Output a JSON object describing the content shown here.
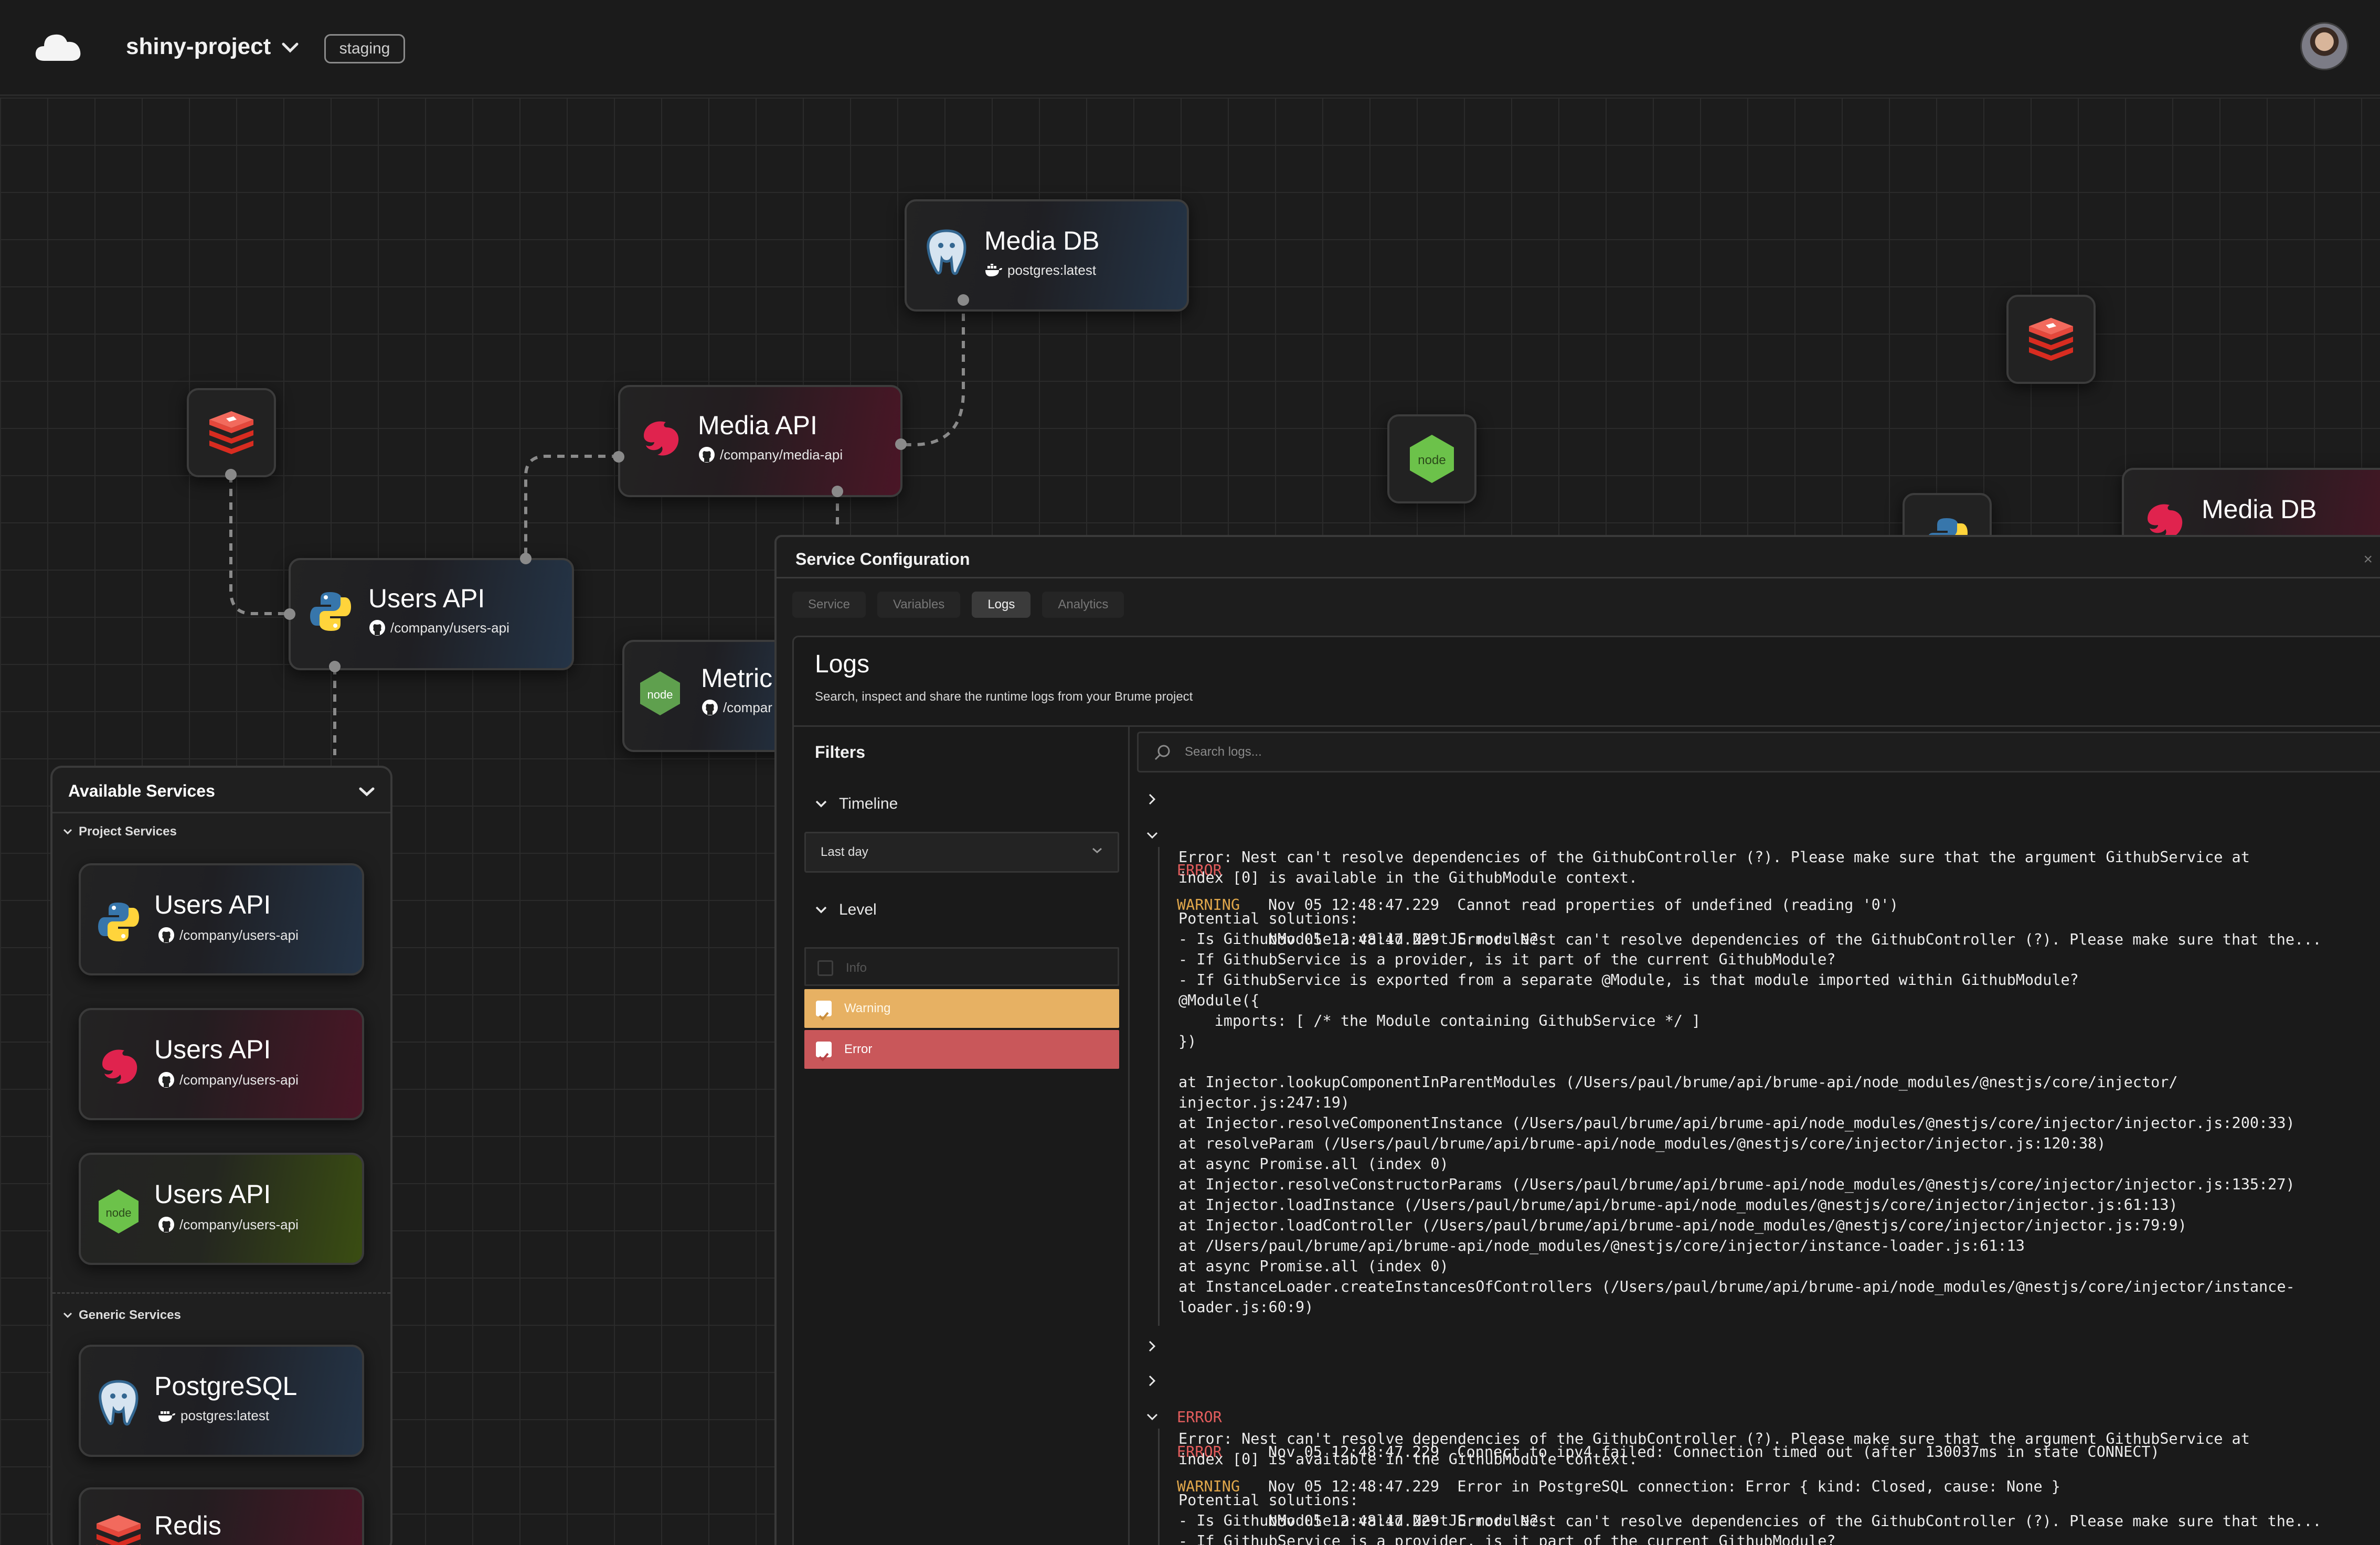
{
  "header": {
    "project_name": "shiny-project",
    "environment": "staging",
    "logo_icon": "cloud-icon",
    "avatar_icon": "user-avatar"
  },
  "canvas": {
    "nodes": {
      "media_db_top": {
        "title": "Media DB",
        "subtitle": "postgres:latest",
        "icon": "postgres-icon"
      },
      "media_api": {
        "title": "Media API",
        "subtitle": "/company/media-api",
        "icon": "nestjs-icon"
      },
      "users_api": {
        "title": "Users API",
        "subtitle": "/company/users-api",
        "icon": "python-icon"
      },
      "metrics": {
        "title": "Metric",
        "subtitle": "/compar",
        "icon": "nodejs-icon"
      },
      "media_db_right": {
        "title": "Media DB",
        "icon": "nestjs-icon"
      }
    }
  },
  "available_services": {
    "title": "Available Services",
    "project_section": "Project Services",
    "generic_section": "Generic Services",
    "project_items": [
      {
        "title": "Users API",
        "subtitle": "/company/users-api",
        "icon": "python-icon"
      },
      {
        "title": "Users API",
        "subtitle": "/company/users-api",
        "icon": "nestjs-icon"
      },
      {
        "title": "Users API",
        "subtitle": "/company/users-api",
        "icon": "nodejs-icon"
      }
    ],
    "generic_items": [
      {
        "title": "PostgreSQL",
        "subtitle": "postgres:latest",
        "icon": "postgres-icon"
      },
      {
        "title": "Redis",
        "icon": "redis-icon"
      }
    ]
  },
  "config": {
    "title": "Service Configuration",
    "close": "×",
    "tabs": [
      "Service",
      "Variables",
      "Logs",
      "Analytics"
    ],
    "active_tab": "Logs",
    "logs": {
      "heading": "Logs",
      "description": "Search, inspect and share the runtime logs from your Brume project",
      "filters_title": "Filters",
      "timeline_label": "Timeline",
      "timeline_value": "Last day",
      "level_label": "Level",
      "levels": [
        {
          "label": "Info",
          "checked": false
        },
        {
          "label": "Warning",
          "checked": true,
          "color": "#e7b163"
        },
        {
          "label": "Error",
          "checked": true,
          "color": "#c9575a"
        }
      ],
      "search_placeholder": "Search logs...",
      "entries": [
        {
          "level": "ERROR",
          "time": "Nov 05 12:48:47.229",
          "message": "Cannot read properties of undefined (reading '0')",
          "expanded": false
        },
        {
          "level": "WARNING",
          "time": "Nov 05 12:48:47.229",
          "message": "Error: Nest can't resolve dependencies of the GithubController (?). Please make sure that the...",
          "expanded": true,
          "detail": "Error: Nest can't resolve dependencies of the GithubController (?). Please make sure that the argument GithubService at\nindex [0] is available in the GithubModule context.\n\nPotential solutions:\n- Is GithubModule a valid NestJS module?\n- If GithubService is a provider, is it part of the current GithubModule?\n- If GithubService is exported from a separate @Module, is that module imported within GithubModule?\n@Module({\n    imports: [ /* the Module containing GithubService */ ]\n})\n\nat Injector.lookupComponentInParentModules (/Users/paul/brume/api/brume-api/node_modules/@nestjs/core/injector/\ninjector.js:247:19)\nat Injector.resolveComponentInstance (/Users/paul/brume/api/brume-api/node_modules/@nestjs/core/injector/injector.js:200:33)\nat resolveParam (/Users/paul/brume/api/brume-api/node_modules/@nestjs/core/injector/injector.js:120:38)\nat async Promise.all (index 0)\nat Injector.resolveConstructorParams (/Users/paul/brume/api/brume-api/node_modules/@nestjs/core/injector/injector.js:135:27)\nat Injector.loadInstance (/Users/paul/brume/api/brume-api/node_modules/@nestjs/core/injector/injector.js:61:13)\nat Injector.loadController (/Users/paul/brume/api/brume-api/node_modules/@nestjs/core/injector/injector.js:79:9)\nat /Users/paul/brume/api/brume-api/node_modules/@nestjs/core/injector/instance-loader.js:61:13\nat async Promise.all (index 0)\nat InstanceLoader.createInstancesOfControllers (/Users/paul/brume/api/brume-api/node_modules/@nestjs/core/injector/instance-\nloader.js:60:9)"
        },
        {
          "level": "ERROR",
          "time": "Nov 05 12:48:47.229",
          "message": "Connect to ipv4 failed: Connection timed out (after 130037ms in state CONNECT)",
          "expanded": false
        },
        {
          "level": "ERROR",
          "time": "Nov 05 12:48:47.229",
          "message": "Error in PostgreSQL connection: Error { kind: Closed, cause: None }",
          "expanded": false
        },
        {
          "level": "WARNING",
          "time": "Nov 05 12:48:47.229",
          "message": "Error: Nest can't resolve dependencies of the GithubController (?). Please make sure that the...",
          "expanded": true,
          "detail": "Error: Nest can't resolve dependencies of the GithubController (?). Please make sure that the argument GithubService at\nindex [0] is available in the GithubModule context.\n\nPotential solutions:\n- Is GithubModule a valid NestJS module?\n- If GithubService is a provider, is it part of the current GithubModule?"
        }
      ]
    }
  },
  "colors": {
    "error": "#e35d5d",
    "warning": "#e0a74b",
    "background": "#1c1c1c"
  }
}
